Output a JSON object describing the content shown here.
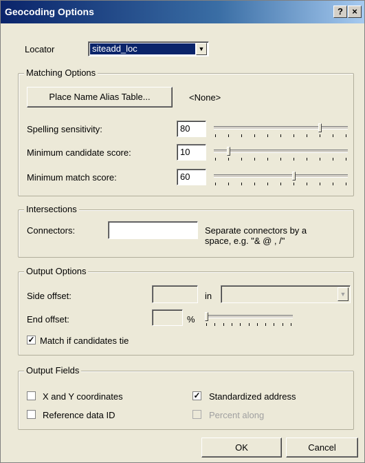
{
  "window": {
    "title": "Geocoding Options",
    "help_glyph": "?",
    "close_glyph": "×"
  },
  "locator": {
    "label": "Locator",
    "value": "siteadd_loc"
  },
  "matching": {
    "legend": "Matching Options",
    "alias_button": "Place Name Alias Table...",
    "alias_value": "<None>",
    "spelling_label": "Spelling sensitivity:",
    "spelling_value": "80",
    "spelling_level": 0.8,
    "min_candidate_label": "Minimum candidate score:",
    "min_candidate_value": "10",
    "min_candidate_level": 0.1,
    "min_match_label": "Minimum match score:",
    "min_match_value": "60",
    "min_match_level": 0.6
  },
  "intersections": {
    "legend": "Intersections",
    "connectors_label": "Connectors:",
    "connectors_value": "",
    "hint_line1": "Separate connectors by a",
    "hint_line2": "space, e.g. \"& @ , /\""
  },
  "output_options": {
    "legend": "Output Options",
    "side_offset_label": "Side offset:",
    "side_offset_value": "",
    "units_label": "in",
    "units_value": "",
    "end_offset_label": "End offset:",
    "end_offset_value": "",
    "percent_label": "%",
    "end_offset_level": 0,
    "match_tie_label": "Match if candidates tie",
    "match_tie_checked": true
  },
  "output_fields": {
    "legend": "Output Fields",
    "xy_label": "X and Y coordinates",
    "xy_checked": false,
    "refid_label": "Reference data ID",
    "refid_checked": false,
    "std_addr_label": "Standardized address",
    "std_addr_checked": true,
    "percent_along_label": "Percent along",
    "percent_along_checked": false
  },
  "buttons": {
    "ok": "OK",
    "cancel": "Cancel"
  }
}
